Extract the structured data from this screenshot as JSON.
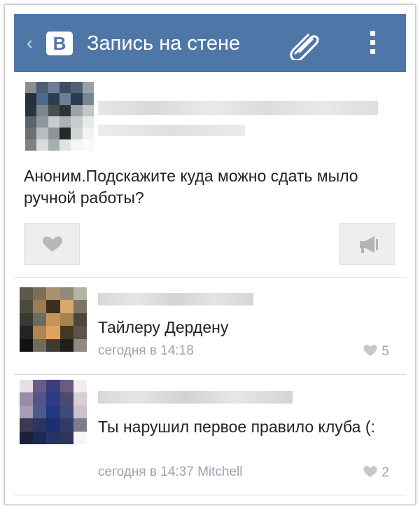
{
  "header": {
    "back_glyph": "‹",
    "logo_letter": "В",
    "title": "Запись на стене"
  },
  "post": {
    "text": "Аноним.Подскажите куда можно сдать мыло ручной работы?"
  },
  "comments": [
    {
      "text": "Тайлеру Дердену",
      "time": "сегодня в 14:18",
      "likes": "5"
    },
    {
      "text": "Ты нарушил первое правило клуба (:",
      "time": "сегодня в 14:37 Mitchell",
      "likes": "2"
    }
  ],
  "colors": {
    "header": "#4e77a8",
    "meta": "#9aa3ad",
    "text": "#222222"
  },
  "icons": [
    "back-icon",
    "vk-logo-icon",
    "paperclip-icon",
    "more-vertical-icon",
    "heart-icon",
    "megaphone-icon"
  ]
}
